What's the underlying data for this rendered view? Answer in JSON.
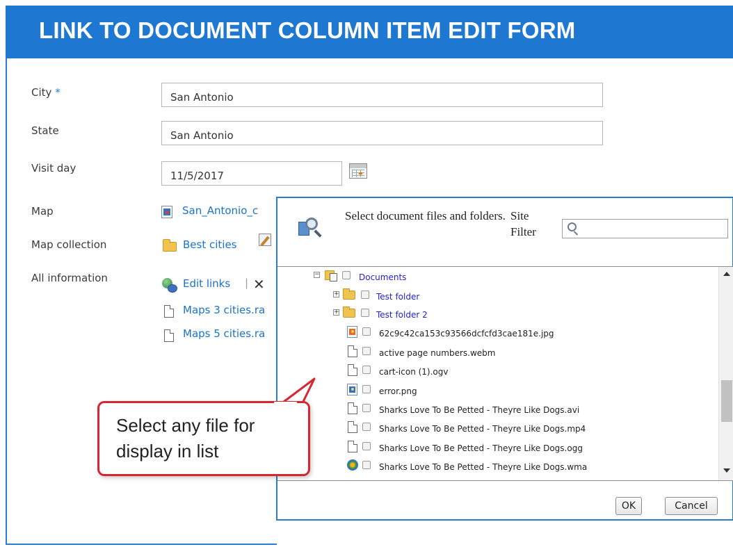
{
  "header": {
    "title": "LINK TO DOCUMENT COLUMN ITEM EDIT FORM"
  },
  "colors": {
    "accent": "#1e78d2",
    "callout_border": "#d6262f",
    "tree_link": "#2222d0"
  },
  "form": {
    "city": {
      "label": "City",
      "required_mark": "*",
      "value": "San Antonio"
    },
    "state": {
      "label": "State",
      "value": "San Antonio"
    },
    "visit_day": {
      "label": "Visit day",
      "value": "11/5/2017",
      "picker_icon": "calendar-icon"
    },
    "map": {
      "label": "Map",
      "link_text": "San_Antonio_c",
      "icon": "image-file-icon"
    },
    "map_collection": {
      "label": "Map collection",
      "link_text": "Best cities",
      "icon": "folder-icon",
      "edit_icon": "edit-icon"
    },
    "all_information": {
      "label": "All information",
      "edit_links_text": "Edit links",
      "separator": "|",
      "files": [
        "Maps 3 cities.ra",
        "Maps 5 cities.ra"
      ]
    }
  },
  "dialog": {
    "title": "Select document files and folders.",
    "filter_label": "Site Filter",
    "search_placeholder": "",
    "tree": [
      {
        "name": "Documents",
        "type": "library",
        "expander": "⊟"
      },
      {
        "name": "Test folder",
        "type": "folder",
        "expander": "⊞"
      },
      {
        "name": "Test folder 2",
        "type": "folder",
        "expander": "⊞"
      },
      {
        "name": "62c9c42ca153c93566dcfcfd3cae181e.jpg",
        "type": "image"
      },
      {
        "name": "active page numbers.webm",
        "type": "doc"
      },
      {
        "name": "cart-icon (1).ogv",
        "type": "doc"
      },
      {
        "name": "error.png",
        "type": "image"
      },
      {
        "name": "Sharks Love To Be Petted - Theyre Like Dogs.avi",
        "type": "doc"
      },
      {
        "name": "Sharks Love To Be Petted - Theyre Like Dogs.mp4",
        "type": "doc"
      },
      {
        "name": "Sharks Love To Be Petted - Theyre Like Dogs.ogg",
        "type": "doc"
      },
      {
        "name": "Sharks Love To Be Petted - Theyre Like Dogs.wma",
        "type": "media"
      }
    ],
    "ok_label": "OK",
    "cancel_label": "Cancel"
  },
  "callout": {
    "line1": "Select any file for",
    "line2": "display in list"
  }
}
